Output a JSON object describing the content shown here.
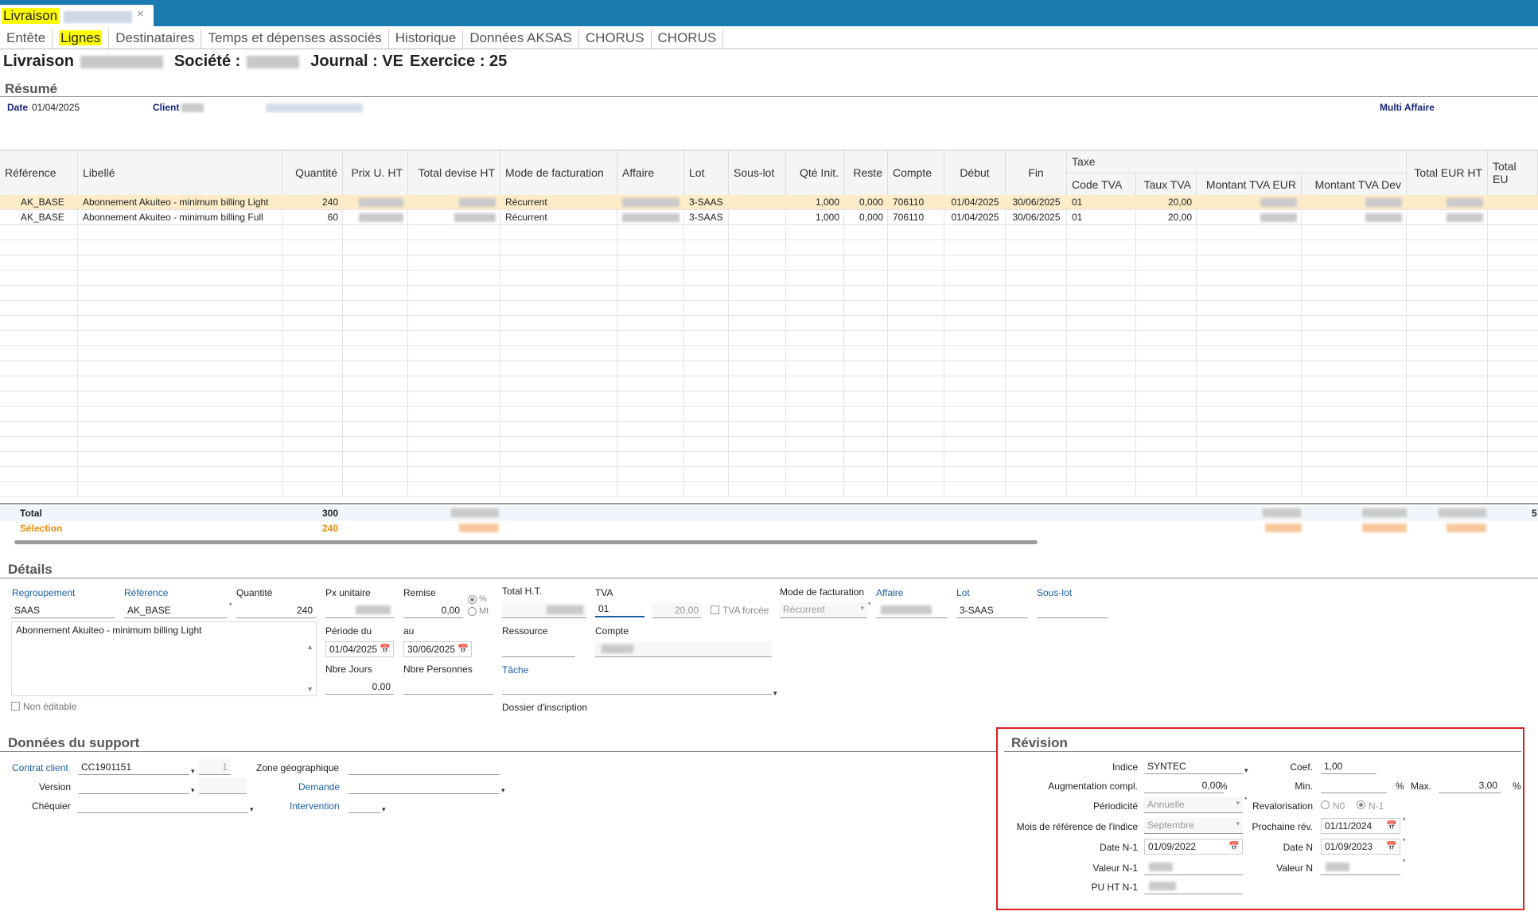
{
  "window": {
    "tab_title": "Livraison",
    "close": "×"
  },
  "subtabs": [
    "Entête",
    "Lignes",
    "Destinataires",
    "Temps et dépenses associés",
    "Historique",
    "Données AKSAS",
    "CHORUS",
    "CHORUS"
  ],
  "header": {
    "livraison": "Livraison",
    "societe": "Société :",
    "journal": "Journal : VE",
    "exercice": "Exercice : 25"
  },
  "resume": {
    "title": "Résumé",
    "date_label": "Date",
    "date_value": "01/04/2025",
    "client_label": "Client",
    "multi_affaire": "Multi Affaire"
  },
  "grid": {
    "headers": {
      "reference": "Référence",
      "libelle": "Libellé",
      "quantite": "Quantité",
      "prix": "Prix U. HT",
      "total_devise": "Total devise HT",
      "mode": "Mode de facturation",
      "affaire": "Affaire",
      "lot": "Lot",
      "souslot": "Sous-lot",
      "qte_init": "Qté Init.",
      "reste": "Reste",
      "compte": "Compte",
      "debut": "Début",
      "fin": "Fin",
      "taxe": "Taxe",
      "code_tva": "Code TVA",
      "taux_tva": "Taux TVA",
      "montant_eur": "Montant TVA EUR",
      "montant_dev": "Montant TVA Dev",
      "total_eur": "Total EUR HT",
      "total_eu2": "Total EU"
    },
    "rows": [
      {
        "reference": "AK_BASE",
        "libelle": "Abonnement Akuiteo - minimum billing Light",
        "quantite": "240",
        "mode": "Récurrent",
        "lot": "3-SAAS",
        "qte_init": "1,000",
        "reste": "0,000",
        "compte": "706110",
        "debut": "01/04/2025",
        "fin": "30/06/2025",
        "code_tva": "01",
        "taux_tva": "20,00"
      },
      {
        "reference": "AK_BASE",
        "libelle": "Abonnement Akuiteo - minimum billing Full",
        "quantite": "60",
        "mode": "Récurrent",
        "lot": "3-SAAS",
        "qte_init": "1,000",
        "reste": "0,000",
        "compte": "706110",
        "debut": "01/04/2025",
        "fin": "30/06/2025",
        "code_tva": "01",
        "taux_tva": "20,00"
      }
    ],
    "total_label": "Total",
    "total_qty": "300",
    "selection_label": "Sélection",
    "selection_qty": "240",
    "total_edge": "5"
  },
  "details": {
    "title": "Détails",
    "regroupement_label": "Regroupement",
    "regroupement_value": "SAAS",
    "reference_label": "Référence",
    "reference_value": "AK_BASE",
    "quantite_label": "Quantité",
    "quantite_value": "240",
    "px_label": "Px unitaire",
    "remise_label": "Remise",
    "remise_value": "0,00",
    "pct": "%",
    "mt": "Mt",
    "total_ht_label": "Total H.T.",
    "tva_label": "TVA",
    "tva_value": "01",
    "tva_rate": "20,00",
    "tva_forcee": "TVA forcée",
    "mode_label": "Mode de facturation",
    "mode_value": "Récurrent",
    "affaire_label": "Affaire",
    "lot_label": "Lot",
    "lot_value": "3-SAAS",
    "souslot_label": "Sous-lot",
    "libelle_value": "Abonnement Akuiteo - minimum billing Light",
    "periode_label": "Période du",
    "periode_du": "01/04/2025",
    "au_label": "au",
    "periode_au": "30/06/2025",
    "ressource_label": "Ressource",
    "compte_label": "Compte",
    "nbre_jours_label": "Nbre Jours",
    "nbre_jours_value": "0,00",
    "nbre_pers_label": "Nbre Personnes",
    "tache_label": "Tâche",
    "non_editable": "Non éditable",
    "dossier_label": "Dossier d'inscription"
  },
  "support": {
    "title": "Données du support",
    "contrat_label": "Contrat client",
    "contrat_value": "CC1901151",
    "contrat_num": "1",
    "zone_label": "Zone géographique",
    "version_label": "Version",
    "demande_label": "Demande",
    "chequier_label": "Chéquier",
    "intervention_label": "Intervention"
  },
  "revision": {
    "title": "Révision",
    "indice_label": "Indice",
    "indice_value": "SYNTEC",
    "coef_label": "Coef.",
    "coef_value": "1,00",
    "augm_label": "Augmentation compl.",
    "augm_value": "0,00",
    "augm_unit": "%",
    "min_label": "Min.",
    "min_unit": "%",
    "max_label": "Max.",
    "max_value": "3,00",
    "max_unit": "%",
    "periodicite_label": "Périodicité",
    "periodicite_value": "Annuelle",
    "revalorisation_label": "Revalorisation",
    "n0": "N0",
    "n1": "N-1",
    "mois_label": "Mois de référence de l'indice",
    "mois_value": "Septembre",
    "prochaine_label": "Prochaine rév.",
    "prochaine_value": "01/11/2024",
    "date_n1_label": "Date N-1",
    "date_n1_value": "01/09/2022",
    "date_n_label": "Date N",
    "date_n_value": "01/09/2023",
    "valeur_n1_label": "Valeur N-1",
    "valeur_n_label": "Valeur N",
    "pu_ht_label": "PU HT N-1"
  }
}
